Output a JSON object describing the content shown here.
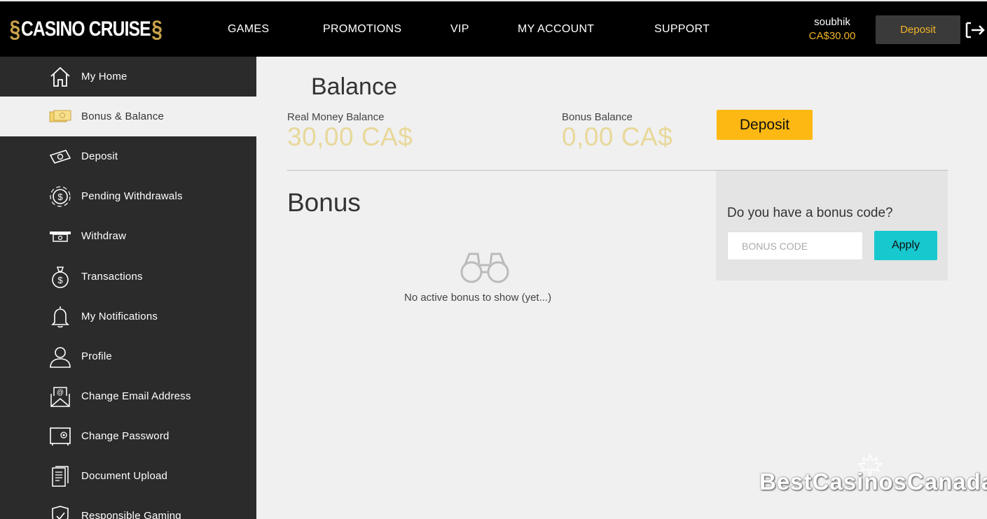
{
  "header": {
    "logo_text": "CASINO CRUISE",
    "nav": [
      "GAMES",
      "PROMOTIONS",
      "VIP",
      "MY ACCOUNT",
      "SUPPORT"
    ],
    "username": "soubhik",
    "balance": "CA$30.00",
    "deposit_label": "Deposit",
    "logout_icon": "logout-icon"
  },
  "sidebar": {
    "items": [
      {
        "label": "My Home",
        "icon": "home-icon",
        "active": false
      },
      {
        "label": "Bonus & Balance",
        "icon": "money-icon",
        "active": true
      },
      {
        "label": "Deposit",
        "icon": "deposit-cash-icon",
        "active": false
      },
      {
        "label": "Pending Withdrawals",
        "icon": "pending-coin-icon",
        "active": false
      },
      {
        "label": "Withdraw",
        "icon": "withdraw-atm-icon",
        "active": false
      },
      {
        "label": "Transactions",
        "icon": "money-bag-icon",
        "active": false
      },
      {
        "label": "My Notifications",
        "icon": "bell-icon",
        "active": false
      },
      {
        "label": "Profile",
        "icon": "user-icon",
        "active": false
      },
      {
        "label": "Change Email Address",
        "icon": "email-icon",
        "active": false
      },
      {
        "label": "Change Password",
        "icon": "safe-icon",
        "active": false
      },
      {
        "label": "Document Upload",
        "icon": "document-icon",
        "active": false
      },
      {
        "label": "Responsible Gaming",
        "icon": "shield-check-icon",
        "active": false
      }
    ]
  },
  "main": {
    "balance_heading": "Balance",
    "real_label": "Real Money Balance",
    "real_value": "30,00 CA$",
    "bonus_label": "Bonus Balance",
    "bonus_value": "0,00 CA$",
    "deposit_label": "Deposit",
    "bonus_heading": "Bonus",
    "empty_text": "No active bonus to show (yet...)",
    "code_question": "Do you have a bonus code?",
    "code_placeholder": "BONUS CODE",
    "apply_label": "Apply"
  },
  "watermark": "BestCasinosCanada",
  "colors": {
    "accent_gold": "#fdb813",
    "teal": "#17c9cf",
    "balance_text": "#e8d89a"
  }
}
